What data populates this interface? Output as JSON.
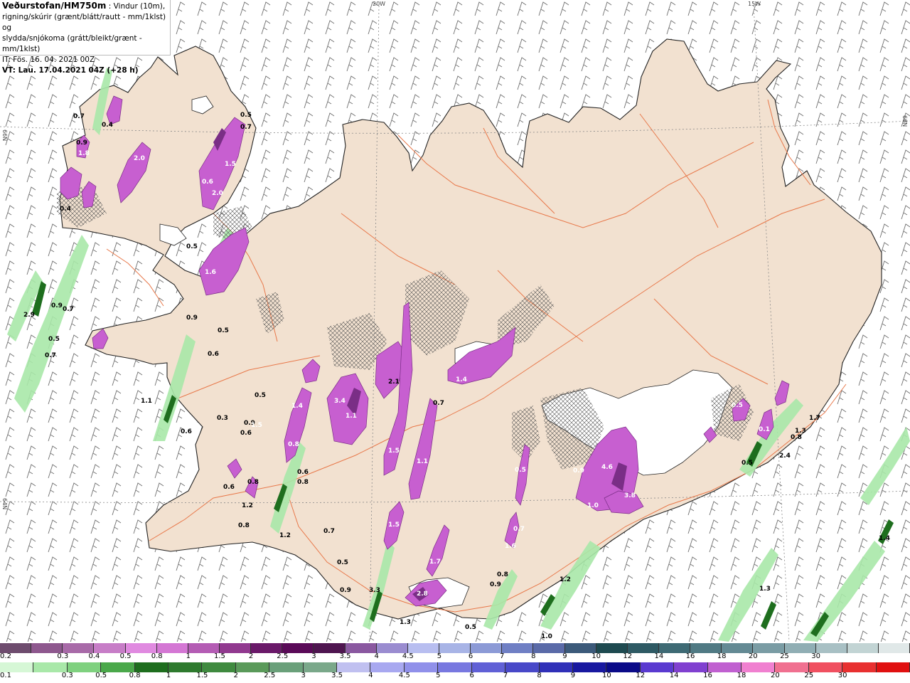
{
  "header": {
    "line1_bold": "Veðurstofan/HM750m",
    "line1_rest": " : Vindur (10m),",
    "line2": "rigning/skúrir (grænt/blátt/rautt - mm/1klst) og",
    "line3": "slydda/snjókoma (grátt/bleikt/grænt - mm/1klst)",
    "line4": "IT: Fös. 16. 04. 2021 00Z",
    "line5": "VT: Lau. 17.04.2021 04Z (+28 h)"
  },
  "grid_labels": {
    "lon_20w": "20W",
    "lon_15w": "15W",
    "lat_66n_left": "66N",
    "lat_66n_right": "66N",
    "lat_64n_left": "64N"
  },
  "map_values": [
    "0.7",
    "0.4",
    "0.9",
    "1.8",
    "2.0",
    "1.5",
    "0.6",
    "2.0",
    "0.5",
    "0.7",
    "0.4",
    "1.6",
    "0.5",
    "0.9",
    "0.7",
    "0.5",
    "0.7",
    "2.9",
    "0.9",
    "0.5",
    "0.6",
    "1.1",
    "0.6",
    "0.5",
    "0.3",
    "0.9",
    "0.6",
    "0.8",
    "0.6",
    "0.8",
    "1.2",
    "1.2",
    "0.7",
    "1.4",
    "0.8",
    "1.4",
    "2.1",
    "3.4",
    "1.1",
    "1.5",
    "1.1",
    "0.5",
    "1.5",
    "1.7",
    "2.8",
    "1.3",
    "0.5",
    "0.9",
    "0.8",
    "1.6",
    "0.7",
    "1.2",
    "1.0",
    "0.5",
    "0.4",
    "0.9",
    "4.6",
    "3.8",
    "1.0",
    "0.5",
    "0.1",
    "1.7",
    "2.4",
    "0.8",
    "1.4",
    "1.3",
    "0.5",
    "1.3",
    "0.9",
    "0.6",
    "0.8",
    "1.5",
    "0.7",
    "3.3"
  ],
  "legend_snow": {
    "colors": [
      "#6e4c6e",
      "#8e588e",
      "#a86aa8",
      "#c77dc7",
      "#e08ae0",
      "#d477d4",
      "#b45cb4",
      "#91398f",
      "#6a1969",
      "#5a0a58",
      "#4f1550",
      "#8a58a0",
      "#9a8cd0",
      "#b8bef0",
      "#a8b4e6",
      "#8c9ad6",
      "#6f7fc4",
      "#5a6aa8",
      "#3c5a7a",
      "#1e4a50",
      "#2e5a64",
      "#3e6a74",
      "#507a84",
      "#648a94",
      "#7a9ca4",
      "#90aeb4",
      "#a8c0c4",
      "#c2d4d4",
      "#e0e8e8"
    ],
    "labels": [
      "0.2",
      "0.3",
      "0.4",
      "0.5",
      "0.8",
      "1",
      "1.5",
      "2",
      "2.5",
      "3",
      "3.5",
      "4",
      "4.5",
      "5",
      "6",
      "7",
      "8",
      "9",
      "10",
      "12",
      "14",
      "16",
      "18",
      "20",
      "25",
      "30"
    ]
  },
  "legend_rain": {
    "colors": [
      "#d6f7d6",
      "#a9e8a9",
      "#7fd17f",
      "#4aa84a",
      "#1e6e1e",
      "#2e7a2e",
      "#3f8a3f",
      "#5a9a5a",
      "#6aa07a",
      "#7aa88a",
      "#c0c0f0",
      "#a8a8f0",
      "#9090ea",
      "#7878e0",
      "#6060d6",
      "#4848c8",
      "#3030b8",
      "#1818a0",
      "#0a0a88",
      "#5a3ad0",
      "#8040d0",
      "#c060d0",
      "#f080d0",
      "#f07090",
      "#f05060",
      "#e83030",
      "#e01010"
    ],
    "labels": [
      "0.1",
      "0.3",
      "0.5",
      "0.8",
      "1",
      "1.5",
      "2",
      "2.5",
      "3",
      "3.5",
      "4",
      "4.5",
      "5",
      "6",
      "7",
      "8",
      "9",
      "10",
      "12",
      "14",
      "16",
      "18",
      "20",
      "25",
      "30"
    ]
  }
}
